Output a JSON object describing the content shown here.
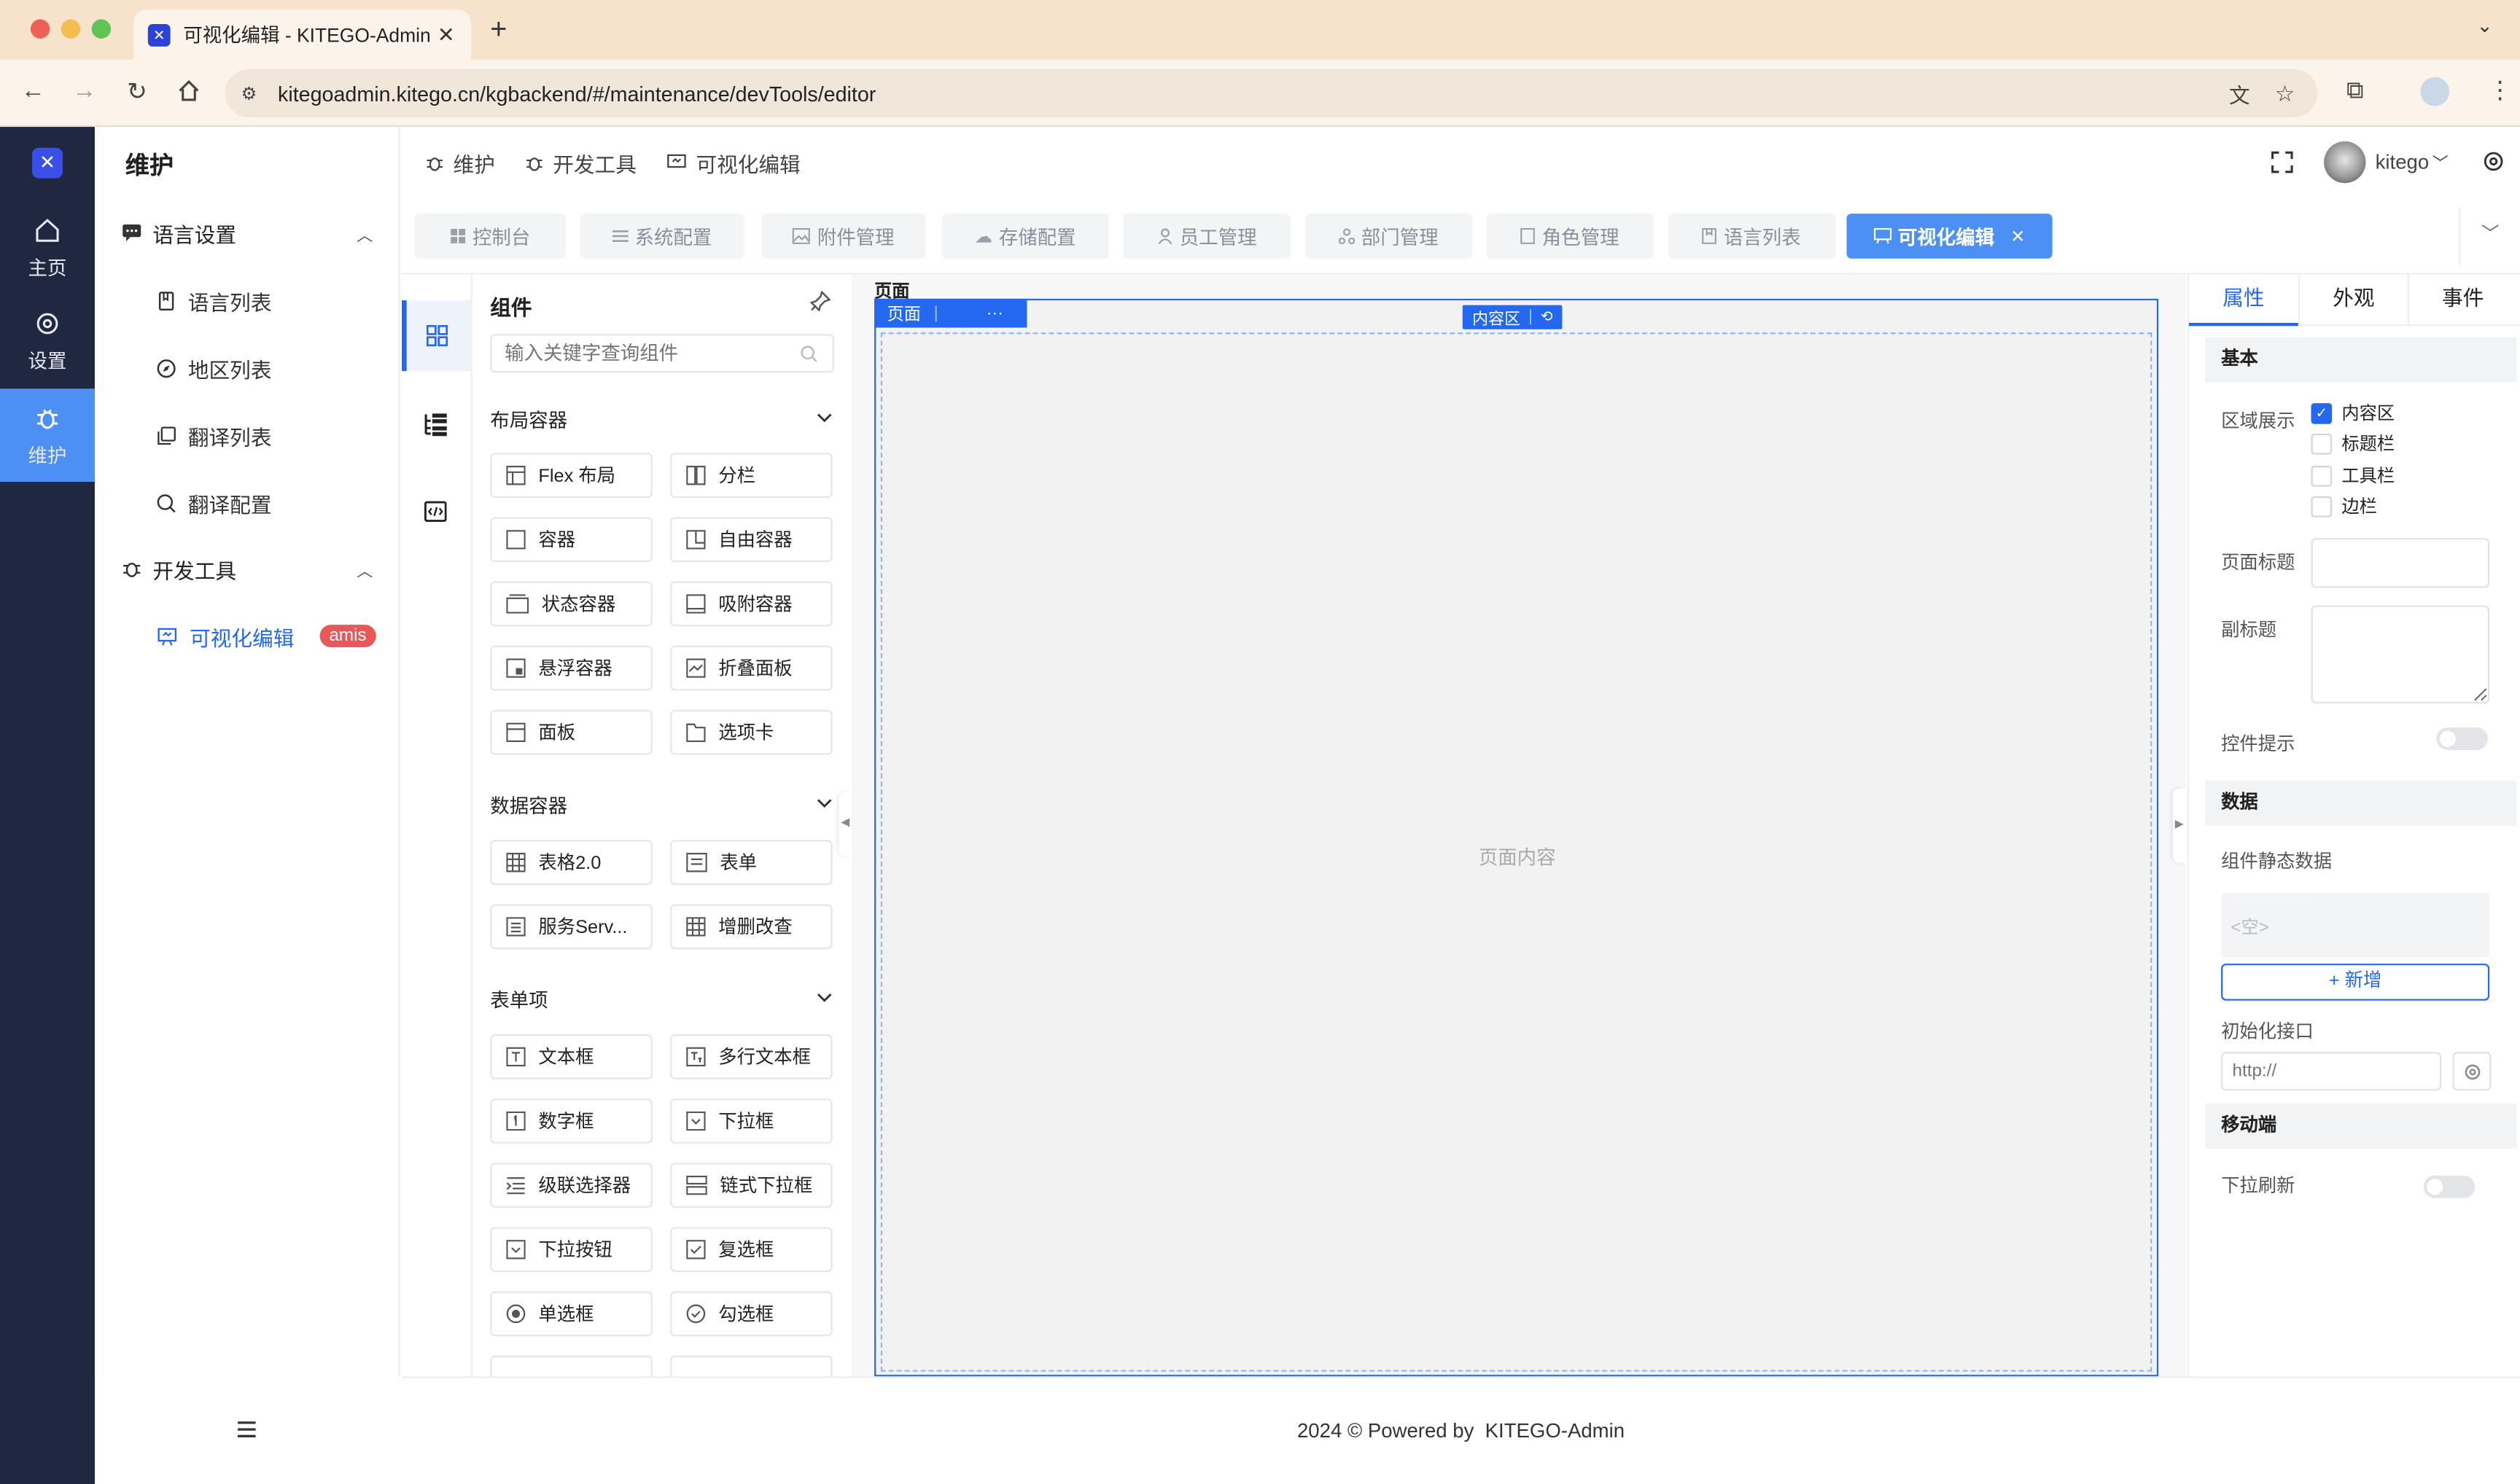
{
  "browser": {
    "tab_title": "可视化编辑 - KITEGO-Admin",
    "url": "kitegoadmin.kitego.cn/kgbackend/#/maintenance/devTools/editor"
  },
  "leftnav": [
    {
      "label": "主页",
      "icon": "home-icon"
    },
    {
      "label": "设置",
      "icon": "gear-icon"
    },
    {
      "label": "维护",
      "icon": "bug-icon",
      "active": true
    }
  ],
  "sidebar": {
    "title": "维护",
    "groups": [
      {
        "label": "语言设置",
        "items": [
          "语言列表",
          "地区列表",
          "翻译列表",
          "翻译配置"
        ]
      },
      {
        "label": "开发工具",
        "items": [
          "可视化编辑"
        ],
        "badge": "amis"
      }
    ]
  },
  "header": {
    "breadcrumbs": [
      "维护",
      "开发工具",
      "可视化编辑"
    ],
    "user": "kitego"
  },
  "page_tabs": [
    "控制台",
    "系统配置",
    "附件管理",
    "存储配置",
    "员工管理",
    "部门管理",
    "角色管理",
    "语言列表",
    "可视化编辑"
  ],
  "components": {
    "title": "组件",
    "search_placeholder": "输入关键字查询组件",
    "sections": [
      {
        "title": "布局容器",
        "items": [
          "Flex 布局",
          "分栏",
          "容器",
          "自由容器",
          "状态容器",
          "吸附容器",
          "悬浮容器",
          "折叠面板",
          "面板",
          "选项卡"
        ]
      },
      {
        "title": "数据容器",
        "items": [
          "表格2.0",
          "表单",
          "服务Serv...",
          "增删改查"
        ]
      },
      {
        "title": "表单项",
        "items": [
          "文本框",
          "多行文本框",
          "数字框",
          "下拉框",
          "级联选择器",
          "链式下拉框",
          "下拉按钮",
          "复选框",
          "单选框",
          "勾选框"
        ]
      }
    ]
  },
  "canvas": {
    "page_label": "页面",
    "tag_page": "页面",
    "tag_more": "···",
    "tag_region": "内容区",
    "placeholder": "页面内容"
  },
  "right_panel": {
    "tabs": [
      "属性",
      "外观",
      "事件"
    ],
    "basic_title": "基本",
    "region_label": "区域展示",
    "region_options": [
      {
        "label": "内容区",
        "checked": true
      },
      {
        "label": "标题栏",
        "checked": false
      },
      {
        "label": "工具栏",
        "checked": false
      },
      {
        "label": "边栏",
        "checked": false
      }
    ],
    "page_title_label": "页面标题",
    "subtitle_label": "副标题",
    "tooltip_label": "控件提示",
    "data_title": "数据",
    "static_data_label": "组件静态数据",
    "empty_text": "<空>",
    "add_button": "+ 新增",
    "init_api_label": "初始化接口",
    "init_api_placeholder": "http://",
    "mobile_title": "移动端",
    "pull_refresh_label": "下拉刷新"
  },
  "footer": {
    "text": "2024 © Powered by  KITEGO-Admin"
  },
  "colors": {
    "nav_bg": "#1f2741",
    "accent": "#2468f2",
    "tab_active": "#4c8ff5",
    "badge": "#e8575a"
  }
}
